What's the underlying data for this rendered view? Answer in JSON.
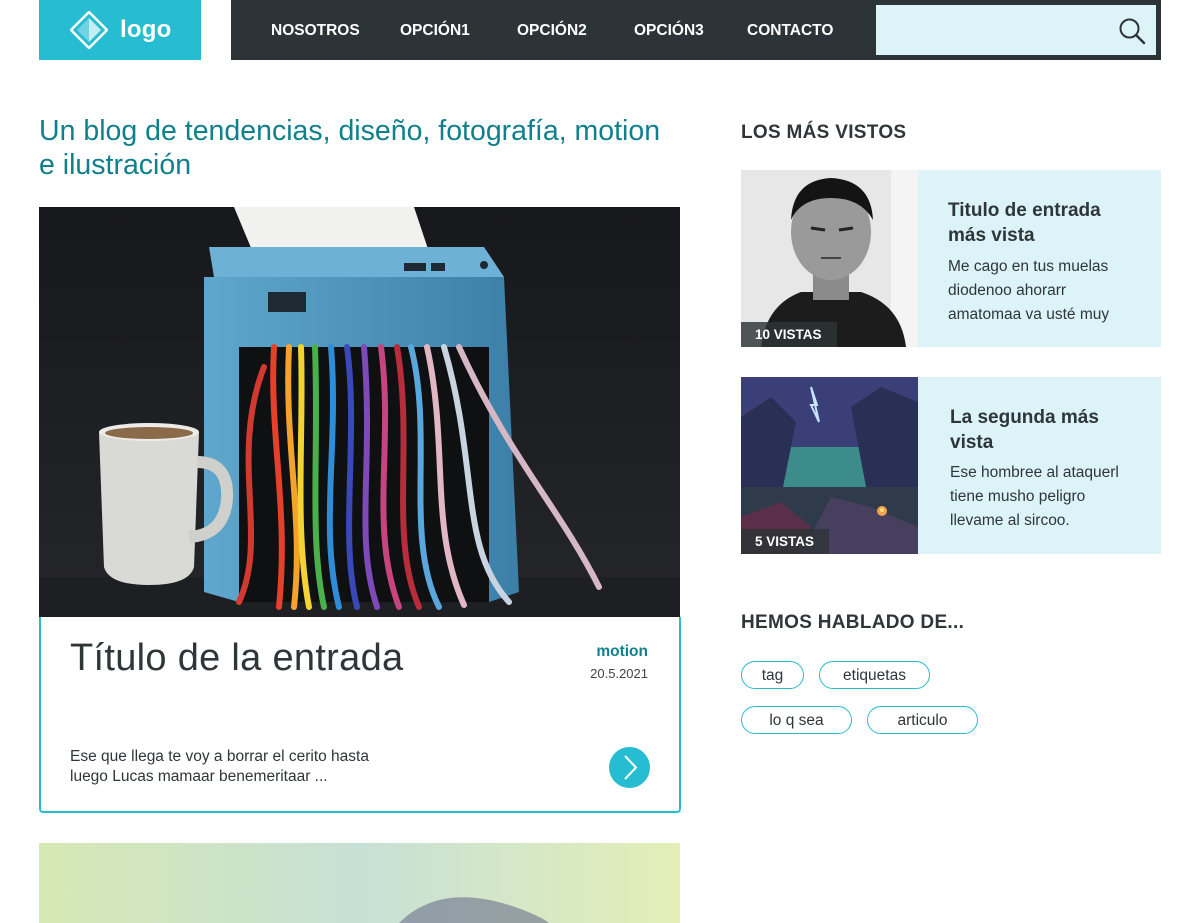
{
  "header": {
    "logo_text": "logo",
    "nav": [
      "NOSOTROS",
      "OPCIÓN1",
      "OPCIÓN2",
      "OPCIÓN3",
      "CONTACTO"
    ],
    "search": {
      "placeholder": "",
      "icon": "search-icon"
    }
  },
  "main": {
    "heading": "Un blog de tendencias, diseño, fotografía, motion e ilustración",
    "post": {
      "title": "Título de la entrada",
      "category": "motion",
      "date": "20.5.2021",
      "excerpt": "Ese que llega te voy a borrar el cerito hasta luego Lucas mamaar benemeritaar ...",
      "read_more_icon": "chevron-right-icon"
    }
  },
  "sidebar": {
    "popular_heading": "LOS MÁS VISTOS",
    "popular": [
      {
        "title": "Titulo de entrada más vista",
        "excerpt": "Me cago en tus muelas diodenoo ahorarr amatomaa va usté muy",
        "views": "10 VISTAS"
      },
      {
        "title": "La segunda más vista",
        "excerpt": "Ese hombree al ataquerl tiene musho peligro llevame al sircoo.",
        "views": "5 VISTAS"
      }
    ],
    "tags_heading": "HEMOS HABLADO DE...",
    "tags": [
      "tag",
      "etiquetas",
      "lo q sea",
      "articulo"
    ]
  },
  "colors": {
    "accent": "#26bcd1",
    "accent_dark": "#11808d",
    "nav_bg": "#2d3437",
    "light_bg": "#dcf4f8"
  }
}
